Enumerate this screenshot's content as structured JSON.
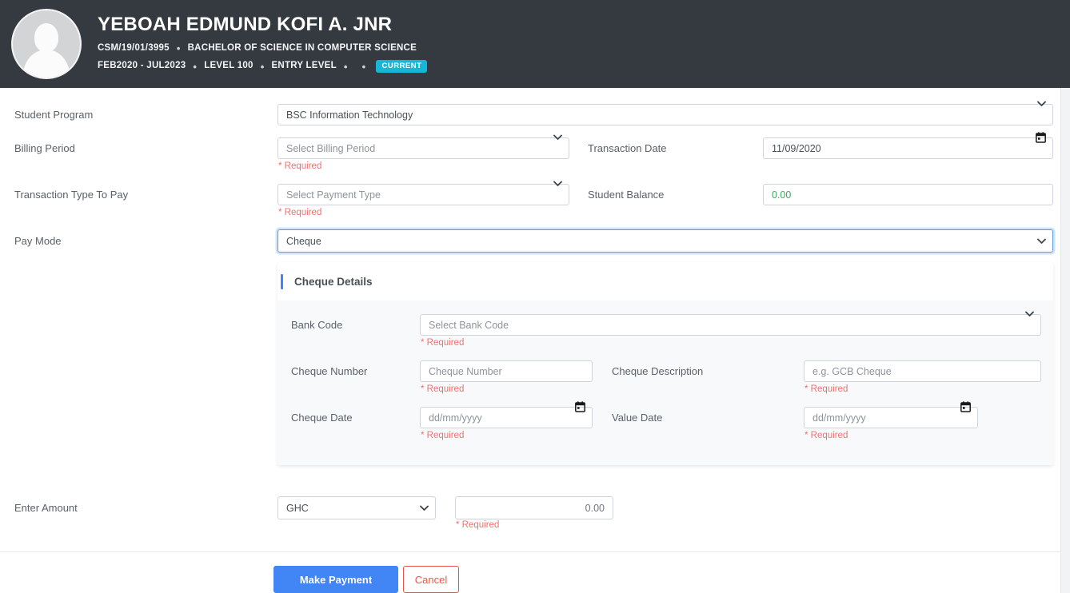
{
  "header": {
    "name": "YEBOAH EDMUND KOFI A. JNR",
    "student_id": "CSM/19/01/3995",
    "program": "BACHELOR OF SCIENCE IN COMPUTER SCIENCE",
    "period": "FEB2020 - JUL2023",
    "level": "LEVEL 100",
    "entry": "ENTRY LEVEL",
    "status_badge": "CURRENT",
    "separator": "•",
    "avatar_icon": "user-avatar-icon",
    "bg_color": "#343a40",
    "badge_color": "#17b6d6"
  },
  "form": {
    "student_program": {
      "label": "Student Program",
      "value": "BSC Information Technology"
    },
    "billing_period": {
      "label": "Billing Period",
      "value": "Select Billing Period",
      "required_text": "* Required"
    },
    "transaction_date": {
      "label": "Transaction Date",
      "value": "11/09/2020"
    },
    "transaction_type": {
      "label": "Transaction Type To Pay",
      "value": "Select Payment Type",
      "required_text": "* Required"
    },
    "student_balance": {
      "label": "Student Balance",
      "value": "0.00"
    },
    "pay_mode": {
      "label": "Pay Mode",
      "value": "Cheque",
      "focus_color": "#5a9bee"
    },
    "enter_amount": {
      "label": "Enter Amount",
      "currency": "GHC",
      "value": "0.00",
      "required_text": "* Required"
    }
  },
  "cheque_details": {
    "title": "Cheque Details",
    "bank_code": {
      "label": "Bank Code",
      "value": "Select Bank Code",
      "required_text": "* Required"
    },
    "cheque_number": {
      "label": "Cheque Number",
      "placeholder": "Cheque Number",
      "required_text": "* Required"
    },
    "cheque_description": {
      "label": "Cheque Description",
      "placeholder": "e.g. GCB Cheque",
      "required_text": "* Required"
    },
    "cheque_date": {
      "label": "Cheque Date",
      "placeholder": "dd/mm/yyyy",
      "required_text": "* Required"
    },
    "value_date": {
      "label": "Value Date",
      "placeholder": "dd/mm/yyyy",
      "required_text": "* Required"
    }
  },
  "actions": {
    "submit_label": "Make Payment",
    "cancel_label": "Cancel",
    "submit_color": "#4285f4",
    "cancel_color": "#e8514c"
  }
}
